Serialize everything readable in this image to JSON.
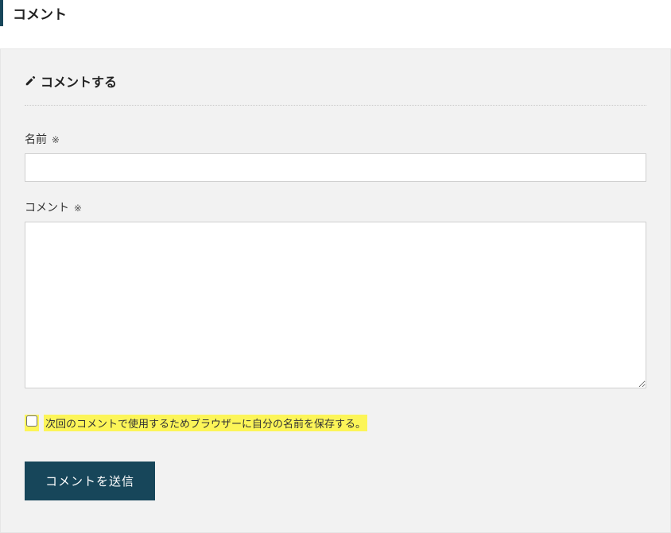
{
  "header": {
    "title": "コメント"
  },
  "form": {
    "heading": "コメントする",
    "name": {
      "label": "名前",
      "required_mark": "※",
      "value": ""
    },
    "comment": {
      "label": "コメント",
      "required_mark": "※",
      "value": ""
    },
    "save_checkbox": {
      "label": "次回のコメントで使用するためブラウザーに自分の名前を保存する。",
      "checked": false
    },
    "submit": {
      "label": "コメントを送信"
    }
  }
}
